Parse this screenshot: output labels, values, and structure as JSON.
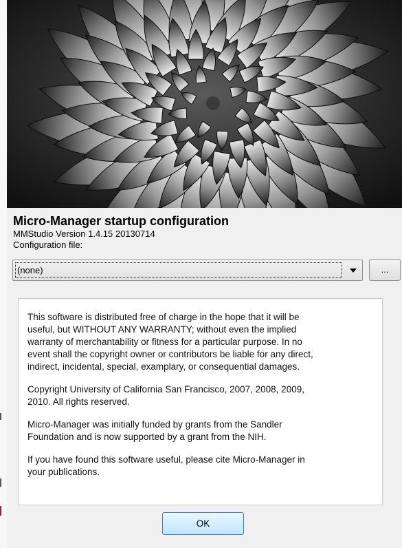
{
  "header": {
    "banner_image": "spiral-aloe-plant-photo",
    "title": "Micro-Manager startup configuration",
    "version": "MMStudio Version 1.4.15  20130714",
    "config_label": "Configuration file:"
  },
  "config": {
    "selected": "(none)",
    "dropdown_icon": "chevron-down-icon",
    "browse_label": "..."
  },
  "license": {
    "paragraphs": [
      "This software is distributed free of charge in the hope that it will be\nuseful, but WITHOUT ANY WARRANTY; without even the implied\nwarranty of merchantability or fitness for a particular purpose. In no\nevent shall the copyright owner or contributors be liable for any direct,\nindirect, incidental, special, examplary, or consequential damages.",
      "Copyright University of California San Francisco, 2007, 2008, 2009,\n2010. All rights reserved.",
      "Micro-Manager was initially funded by grants from the Sandler\nFoundation and is now supported by a grant from the NIH.",
      "If you have found this software useful, please cite Micro-Manager in\nyour publications."
    ]
  },
  "actions": {
    "ok_label": "OK"
  },
  "colors": {
    "dialog_bg": "#f0f0f0",
    "ok_border": "#3c7fb1",
    "ok_fill": "#bee6fd"
  }
}
